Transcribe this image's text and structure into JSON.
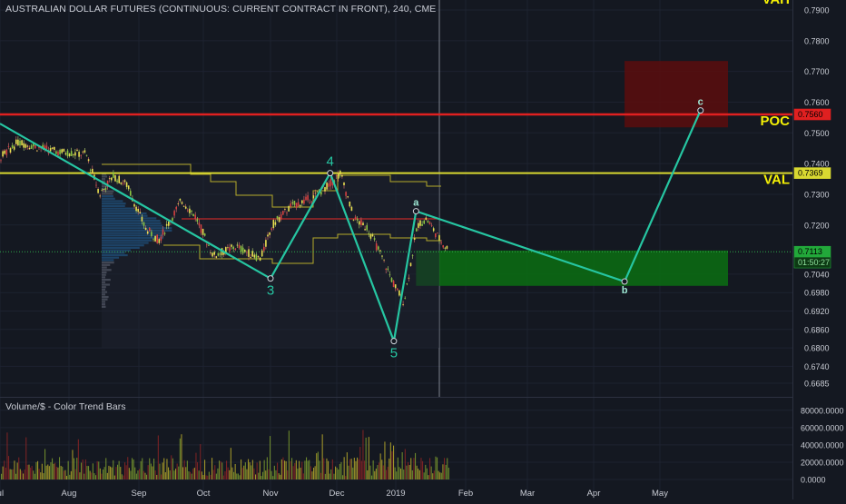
{
  "header": {
    "title": "AUSTRALIAN DOLLAR FUTURES (CONTINUOUS: CURRENT CONTRACT IN FRONT), 240, CME"
  },
  "volume_panel": {
    "title": "Volume/$ - Color Trend Bars"
  },
  "colors": {
    "background": "#141821",
    "axis_text": "#c9ccd4",
    "wave_line": "#26c6a2",
    "level_label": "#f5f005",
    "poc_line": "#e02020",
    "val_line": "#d8d831",
    "profile_yellow": "#b5aa2a",
    "target_zone": "#0b6e12",
    "resistance_zone": "#5a0d0d",
    "volume_bar_green": "#6e8b2c",
    "volume_bar_red": "#8b2020"
  },
  "chart_data": {
    "type": "line",
    "title": "AUSTRALIAN DOLLAR FUTURES (CONTINUOUS: CURRENT CONTRACT IN FRONT), 240, CME",
    "xlabel": "",
    "ylabel": "",
    "x_tick_labels": [
      "Jul",
      "Aug",
      "Sep",
      "Oct",
      "Nov",
      "Dec",
      "2019",
      "Feb",
      "Mar",
      "Apr",
      "May"
    ],
    "y_tick_labels": [
      "0.7900",
      "0.7800",
      "0.7700",
      "0.7600",
      "0.7500",
      "0.7400",
      "0.7300",
      "0.7200",
      "0.7040",
      "0.6980",
      "0.6920",
      "0.6860",
      "0.6800",
      "0.6740",
      "0.6685"
    ],
    "ylim": [
      0.665,
      0.792
    ],
    "grid": true,
    "price_markers": [
      {
        "value": 0.756,
        "label": "0.7560",
        "color": "#e02020"
      },
      {
        "value": 0.7369,
        "label": "0.7369",
        "color": "#d8d831"
      },
      {
        "value": 0.7113,
        "label": "0.7113",
        "color": "#22a83a"
      },
      {
        "value": 0.7078,
        "label": "01:50:27",
        "color": "#22a83a"
      }
    ],
    "levels": [
      {
        "name": "VAH",
        "value": 0.792
      },
      {
        "name": "POC",
        "value": 0.756
      },
      {
        "name": "VAL",
        "value": 0.7369
      }
    ],
    "wave_labels": [
      {
        "label": "3",
        "x": "2018-11-01",
        "y": 0.7026
      },
      {
        "label": "4",
        "x": "2018-11-28",
        "y": 0.7369
      },
      {
        "label": "5",
        "x": "2018-12-31",
        "y": 0.6822
      },
      {
        "label": "a",
        "x": "2019-01-10",
        "y": 0.7245
      },
      {
        "label": "b",
        "x": "2019-04-15",
        "y": 0.7016
      },
      {
        "label": "c",
        "x": "2019-05-20",
        "y": 0.7573
      }
    ],
    "zones": [
      {
        "name": "resistance",
        "x_from": "2019-04-15",
        "x_to": "2019-06-01",
        "y_from": 0.7518,
        "y_to": 0.7734
      },
      {
        "name": "target",
        "x_from": "2019-01-10",
        "x_to": "2019-06-01",
        "y_from": 0.7002,
        "y_to": 0.7117
      }
    ],
    "volume_y_tick_labels": [
      "80000.0000",
      "60000.0000",
      "40000.0000",
      "20000.0000",
      "0.0000"
    ],
    "volume_ylim": [
      0,
      85000
    ]
  }
}
